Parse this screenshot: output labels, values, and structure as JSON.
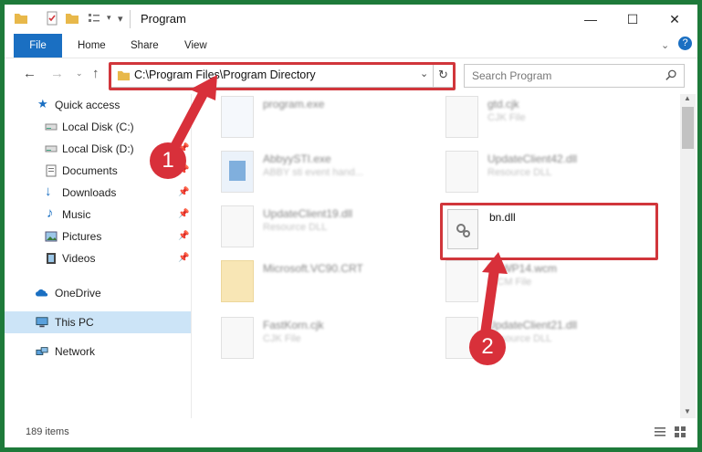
{
  "window": {
    "title": "Program",
    "minimize_glyph": "—",
    "maximize_glyph": "☐",
    "close_glyph": "✕"
  },
  "ribbon": {
    "tabs": [
      "File",
      "Home",
      "Share",
      "View"
    ]
  },
  "navigation": {
    "address": "C:\\Program Files\\Program Directory",
    "search_placeholder": "Search Program"
  },
  "sidebar": {
    "items": [
      {
        "label": "Quick access",
        "icon": "star-icon"
      },
      {
        "label": "Local Disk (C:)",
        "icon": "drive-icon"
      },
      {
        "label": "Local Disk (D:)",
        "icon": "drive-icon"
      },
      {
        "label": "Documents",
        "icon": "documents-icon"
      },
      {
        "label": "Downloads",
        "icon": "download-arrow-icon"
      },
      {
        "label": "Music",
        "icon": "music-note-icon"
      },
      {
        "label": "Pictures",
        "icon": "pictures-icon"
      },
      {
        "label": "Videos",
        "icon": "video-icon"
      },
      {
        "label": "OneDrive",
        "icon": "cloud-icon"
      },
      {
        "label": "This PC",
        "icon": "computer-icon"
      },
      {
        "label": "Network",
        "icon": "network-icon"
      }
    ]
  },
  "files": [
    {
      "name": "program.exe",
      "type": ""
    },
    {
      "name": "gtd.cjk",
      "type": "CJK File"
    },
    {
      "name": "AbbyySTI.exe",
      "type": "ABBY sti event hand..."
    },
    {
      "name": "UpdateClient42.dll",
      "type": "Resource DLL"
    },
    {
      "name": "UpdateClient19.dll",
      "type": "Resource DLL"
    },
    {
      "name": "bn.dll",
      "type": ""
    },
    {
      "name": "Microsoft.VC90.CRT",
      "type": ""
    },
    {
      "name": "RoWP14.wcm",
      "type": "WCM File"
    },
    {
      "name": "FastKorn.cjk",
      "type": "CJK File"
    },
    {
      "name": "UpdateClient21.dll",
      "type": "Resource DLL"
    }
  ],
  "status": {
    "item_count": "189 items"
  },
  "annotations": {
    "badge1": "1",
    "badge2": "2",
    "highlight_color": "#d1363b"
  }
}
